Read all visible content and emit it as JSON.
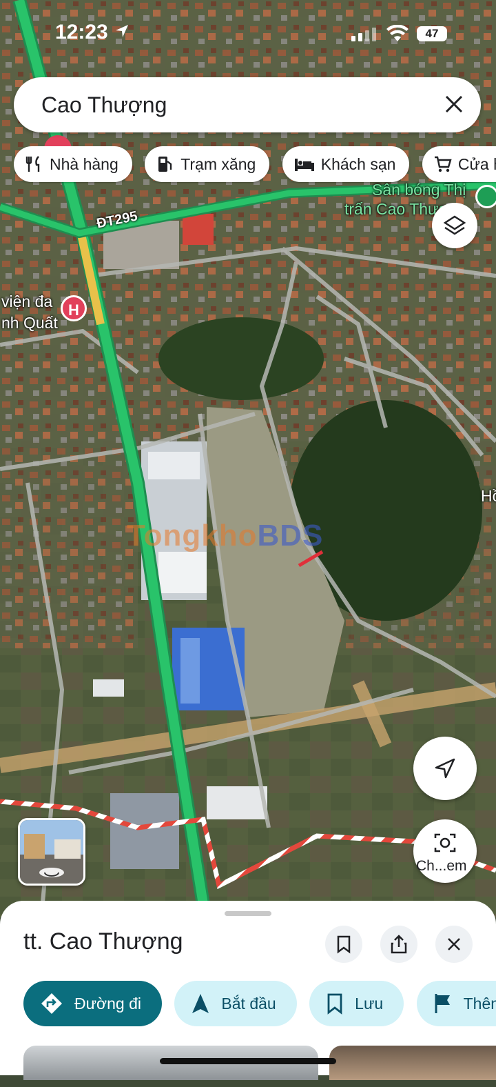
{
  "status_bar": {
    "time": "12:23",
    "battery": "47"
  },
  "search": {
    "query": "Cao Thượng"
  },
  "chips": [
    {
      "label": "Nhà hàng",
      "icon": "fork-knife-icon"
    },
    {
      "label": "Trạm xăng",
      "icon": "gas-pump-icon"
    },
    {
      "label": "Khách sạn",
      "icon": "bed-icon"
    },
    {
      "label": "Cửa h",
      "icon": "cart-icon"
    }
  ],
  "map": {
    "road_label": "ĐT295",
    "hospital_label_line1": "viện đa",
    "hospital_label_line2": "nh Quất",
    "stadium_label_line1": "Sân bóng Thị",
    "stadium_label_line2": "trấn Cao Thượ",
    "right_edge_label": "Hồ",
    "watermark": "Tongkho",
    "watermark_suffix": "BDS"
  },
  "lens_button": {
    "label": "Ch...em"
  },
  "place": {
    "title": "tt. Cao Thượng",
    "actions": [
      {
        "label": "Đường đi",
        "icon": "directions-icon"
      },
      {
        "label": "Bắt đầu",
        "icon": "navigation-arrow-icon"
      },
      {
        "label": "Lưu",
        "icon": "bookmark-icon"
      },
      {
        "label": "Thêm",
        "icon": "flag-icon"
      }
    ]
  },
  "colors": {
    "highway": "#29c36a",
    "primary_action": "#0b6e7e",
    "secondary_action": "#d2f2f8",
    "hospital_marker": "#e2405b"
  }
}
